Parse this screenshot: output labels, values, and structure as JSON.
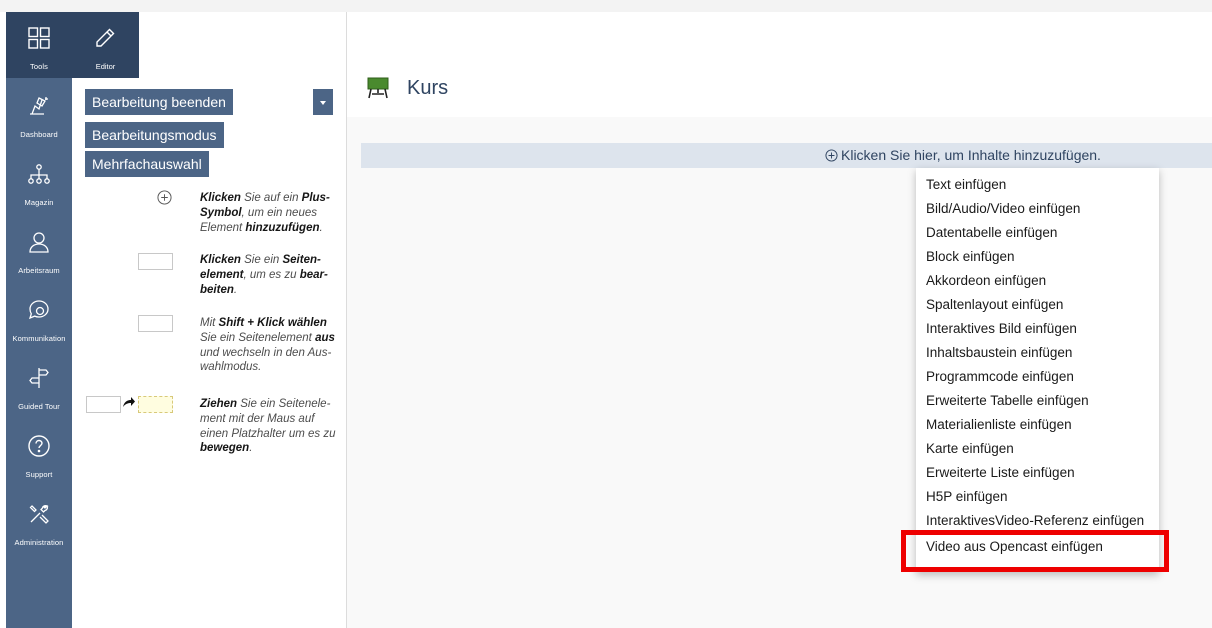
{
  "rail": {
    "items": [
      {
        "label": "Tools",
        "icon": "grid-icon"
      },
      {
        "label": "Dashboard",
        "icon": "dashboard-icon"
      },
      {
        "label": "Magazin",
        "icon": "sitemap-icon"
      },
      {
        "label": "Arbeitsraum",
        "icon": "user-icon"
      },
      {
        "label": "Kommunikation",
        "icon": "chat-icon"
      },
      {
        "label": "Guided Tour",
        "icon": "signpost-icon"
      },
      {
        "label": "Support",
        "icon": "help-icon"
      },
      {
        "label": "Administration",
        "icon": "tools-icon"
      }
    ]
  },
  "editor_tab": {
    "label": "Editor",
    "icon": "pencil-icon"
  },
  "slate": {
    "finish_editing_label": "Bearbeitung beenden",
    "edit_mode_label": "Bearbeitungsmodus",
    "multi_select_label": "Mehrfachauswahl",
    "help": [
      {
        "b1": "Klicken",
        "t1": " Sie auf ein ",
        "b2": "Plus-Symbol",
        "t2": ", um ein neues Element ",
        "b3": "hinzuzufügen",
        "t3": "."
      },
      {
        "b1": "Klicken",
        "t1": " Sie ein ",
        "b2": "Seiten-element",
        "t2": ", um es zu ",
        "b3": "bear-beiten",
        "t3": "."
      },
      {
        "t0": "Mit ",
        "b1": "Shift + Klick wählen",
        "t1": " Sie ein Seitenelement ",
        "b2": "aus",
        "t2": " und wechseln in den Aus-wahlmodus."
      },
      {
        "b1": "Ziehen",
        "t1": " Sie ein Seitenele-ment mit der Maus auf einen Platzhalter um es zu ",
        "b2": "bewegen",
        "t2": "."
      }
    ]
  },
  "page": {
    "title": "Kurs",
    "add_content_label": "Klicken Sie hier, um Inhalte hinzuzufügen."
  },
  "menu": {
    "items": [
      "Text einfügen",
      "Bild/Audio/Video einfügen",
      "Datentabelle einfügen",
      "Block einfügen",
      "Akkordeon einfügen",
      "Spaltenlayout einfügen",
      "Interaktives Bild einfügen",
      "Inhaltsbaustein einfügen",
      "Programmcode einfügen",
      "Erweiterte Tabelle einfügen",
      "Materialienliste einfügen",
      "Karte einfügen",
      "Erweiterte Liste einfügen",
      "H5P einfügen",
      "InteraktivesVideo-Referenz einfügen",
      "Video aus Opencast einfügen"
    ]
  },
  "colors": {
    "rail": "#4c6586",
    "rail_active": "#2f4461",
    "add_bar": "#dde4ed",
    "highlight": "#ee0000"
  }
}
